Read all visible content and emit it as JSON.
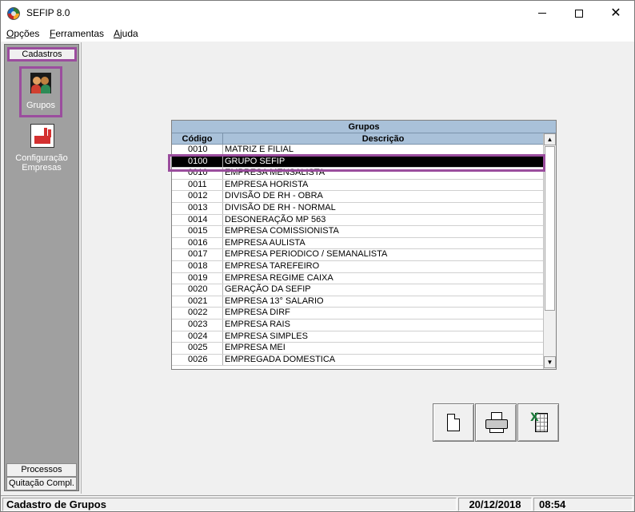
{
  "window": {
    "title": "SEFIP 8.0",
    "controls": {
      "minimize": "",
      "maximize": "",
      "close": "✕"
    }
  },
  "menu": {
    "items": [
      {
        "accel": "O",
        "rest": "pções"
      },
      {
        "accel": "F",
        "rest": "erramentas"
      },
      {
        "accel": "A",
        "rest": "juda"
      }
    ]
  },
  "sidebar": {
    "header": "Cadastros",
    "items": [
      {
        "label": "Grupos",
        "icon": "groups-icon"
      },
      {
        "label": "Configuração Empresas",
        "line1": "Configuração",
        "line2": "Empresas",
        "icon": "factory-icon"
      }
    ],
    "footer": [
      "Processos",
      "Quitação Compl."
    ]
  },
  "grid": {
    "title": "Grupos",
    "columns": [
      "Código",
      "Descrição"
    ],
    "selected_index": 1,
    "rows": [
      {
        "code": "0010",
        "desc": "MATRIZ E FILIAL"
      },
      {
        "code": "0100",
        "desc": "GRUPO SEFIP"
      },
      {
        "code": "0010",
        "desc": "EMPRESA MENSALISTA"
      },
      {
        "code": "0011",
        "desc": "EMPRESA HORISTA"
      },
      {
        "code": "0012",
        "desc": "DIVISÃO DE RH - OBRA"
      },
      {
        "code": "0013",
        "desc": "DIVISÃO DE RH - NORMAL"
      },
      {
        "code": "0014",
        "desc": "DESONERAÇÃO MP 563"
      },
      {
        "code": "0015",
        "desc": "EMPRESA COMISSIONISTA"
      },
      {
        "code": "0016",
        "desc": "EMPRESA AULISTA"
      },
      {
        "code": "0017",
        "desc": "EMPRESA PERIODICO / SEMANALISTA"
      },
      {
        "code": "0018",
        "desc": "EMPRESA TAREFEIRO"
      },
      {
        "code": "0019",
        "desc": "EMPRESA REGIME CAIXA"
      },
      {
        "code": "0020",
        "desc": "GERAÇÃO DA SEFIP"
      },
      {
        "code": "0021",
        "desc": "EMPRESA 13° SALARIO"
      },
      {
        "code": "0022",
        "desc": "EMPRESA DIRF"
      },
      {
        "code": "0023",
        "desc": "EMPRESA RAIS"
      },
      {
        "code": "0024",
        "desc": "EMPRESA SIMPLES"
      },
      {
        "code": "0025",
        "desc": "EMPRESA MEI"
      },
      {
        "code": "0026",
        "desc": "EMPREGADA DOMESTICA"
      }
    ],
    "scroll_up": "▲",
    "scroll_down": "▼"
  },
  "actions": [
    {
      "name": "new-button",
      "icon": "new-document-icon"
    },
    {
      "name": "print-button",
      "icon": "printer-icon"
    },
    {
      "name": "export-excel-button",
      "icon": "excel-icon"
    }
  ],
  "status": {
    "message": "Cadastro de Grupos",
    "date": "20/12/2018",
    "time": "08:54"
  },
  "colors": {
    "highlight_outline": "#9b4d9e",
    "grid_header": "#a9c1d9",
    "selected_row": "#000000",
    "sidebar_bg": "#a0a0a0"
  }
}
